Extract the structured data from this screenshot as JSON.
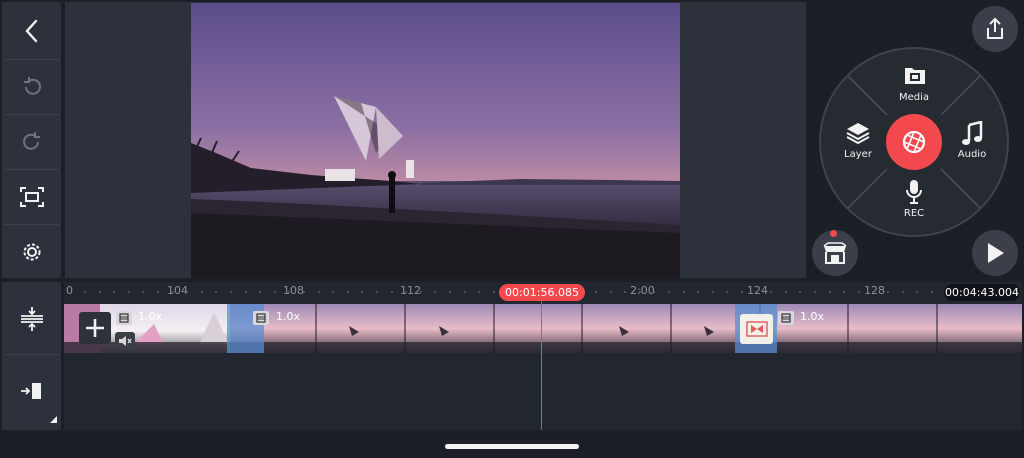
{
  "toolbar": {
    "back_icon": "chevron-left-icon",
    "undo_icon": "undo-icon",
    "redo_icon": "redo-icon",
    "fullscreen_icon": "screen-capture-icon",
    "settings_icon": "gear-icon",
    "track_icon": "track-height-icon",
    "insert_icon": "jump-to-end-icon"
  },
  "wheel": {
    "media_label": "Media",
    "layer_label": "Layer",
    "audio_label": "Audio",
    "rec_label": "REC"
  },
  "timeline": {
    "ruler_labels": [
      "0",
      "104",
      "108",
      "112",
      "2:00",
      "124",
      "128"
    ],
    "current_time": "00:01:56.085",
    "total_time": "00:04:43.004",
    "clip_speed_1": "1.0x",
    "clip_speed_2": "1.0x",
    "clip_speed_3": "1.0x"
  },
  "colors": {
    "accent": "#f2484e",
    "panel": "#2c313b",
    "background": "#1c1f26",
    "transition": "#588cd2"
  }
}
